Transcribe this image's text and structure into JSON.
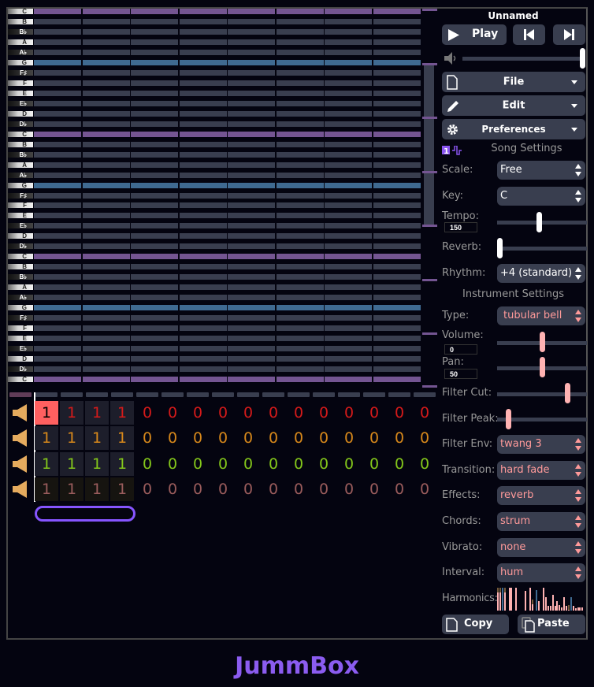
{
  "app": {
    "name": "JummBox",
    "song_title": "Unnamed"
  },
  "piano_keys": [
    "C",
    "B",
    "B♭",
    "A",
    "A♭",
    "G",
    "F♯",
    "F",
    "E",
    "E♭",
    "D",
    "D♭",
    "C",
    "B",
    "B♭",
    "A",
    "A♭",
    "G",
    "F♯",
    "F",
    "E",
    "E♭",
    "D",
    "D♭",
    "C",
    "B",
    "B♭",
    "A",
    "A♭",
    "G",
    "F♯",
    "F",
    "E",
    "E♭",
    "D",
    "D♭",
    "C"
  ],
  "pattern_editor": {
    "bars_visible": 8,
    "octave_root_color": "#745592",
    "fifth_color": "#3f6a91",
    "cell_color": "#393e4f"
  },
  "transport": {
    "play_label": "Play",
    "prev_bar_icon": "skip-back-icon",
    "next_bar_icon": "skip-forward-icon",
    "volume": 1.0
  },
  "menus": [
    {
      "label": "File",
      "icon": "file-icon"
    },
    {
      "label": "Edit",
      "icon": "pencil-icon"
    },
    {
      "label": "Preferences",
      "icon": "gear-icon"
    }
  ],
  "song_settings": {
    "header": "Song Settings",
    "scale_label": "Scale:",
    "scale_value": "Free",
    "key_label": "Key:",
    "key_value": "C",
    "tempo_label": "Tempo:",
    "tempo_value": "150",
    "tempo_slider": 0.47,
    "reverb_label": "Reverb:",
    "reverb_slider": 0.0,
    "rhythm_label": "Rhythm:",
    "rhythm_value": "+4 (standard)"
  },
  "instrument_settings": {
    "header": "Instrument Settings",
    "type_label": "Type:",
    "type_value": "tubular bell",
    "volume_label": "Volume:",
    "volume_value": "0",
    "volume_slider": 0.5,
    "pan_label": "Pan:",
    "pan_value": "50",
    "pan_slider": 0.5,
    "filter_cut_label": "Filter Cut:",
    "filter_cut_slider": 0.8,
    "filter_peak_label": "Filter Peak:",
    "filter_peak_slider": 0.1,
    "filter_env_label": "Filter Env:",
    "filter_env_value": "twang 3",
    "transition_label": "Transition:",
    "transition_value": "hard fade",
    "effects_label": "Effects:",
    "effects_value": "reverb",
    "chords_label": "Chords:",
    "chords_value": "strum",
    "vibrato_label": "Vibrato:",
    "vibrato_value": "none",
    "interval_label": "Interval:",
    "interval_value": "hum",
    "harmonics_label": "Harmonics:",
    "harmonics": [
      1,
      1,
      1,
      1,
      0,
      1,
      1,
      0,
      1,
      0,
      0,
      0,
      0.85,
      0,
      1,
      0.5,
      0,
      0.9,
      0.4,
      0,
      1,
      0.6,
      0.2,
      0.2,
      0.7,
      0.2,
      0.4,
      0.25,
      0.15,
      0.6,
      0.2,
      0.25,
      0.6,
      0.2,
      0.1,
      0.15,
      0.15,
      0.15
    ]
  },
  "clipboard": {
    "copy_label": "Copy",
    "paste_label": "Paste"
  },
  "tracks": [
    {
      "color": "#d51a1a",
      "patterns": [
        "1",
        "1",
        "1",
        "1",
        "0",
        "0",
        "0",
        "0",
        "0",
        "0",
        "0",
        "0",
        "0",
        "0",
        "0",
        "0"
      ]
    },
    {
      "color": "#d7881b",
      "patterns": [
        "1",
        "1",
        "1",
        "1",
        "0",
        "0",
        "0",
        "0",
        "0",
        "0",
        "0",
        "0",
        "0",
        "0",
        "0",
        "0"
      ]
    },
    {
      "color": "#84c71b",
      "patterns": [
        "1",
        "1",
        "1",
        "1",
        "0",
        "0",
        "0",
        "0",
        "0",
        "0",
        "0",
        "0",
        "0",
        "0",
        "0",
        "0"
      ]
    },
    {
      "color": "#9a5c5c",
      "patterns": [
        "1",
        "1",
        "1",
        "1",
        "0",
        "0",
        "0",
        "0",
        "0",
        "0",
        "0",
        "0",
        "0",
        "0",
        "0",
        "0"
      ]
    }
  ],
  "selected_bar": 0
}
